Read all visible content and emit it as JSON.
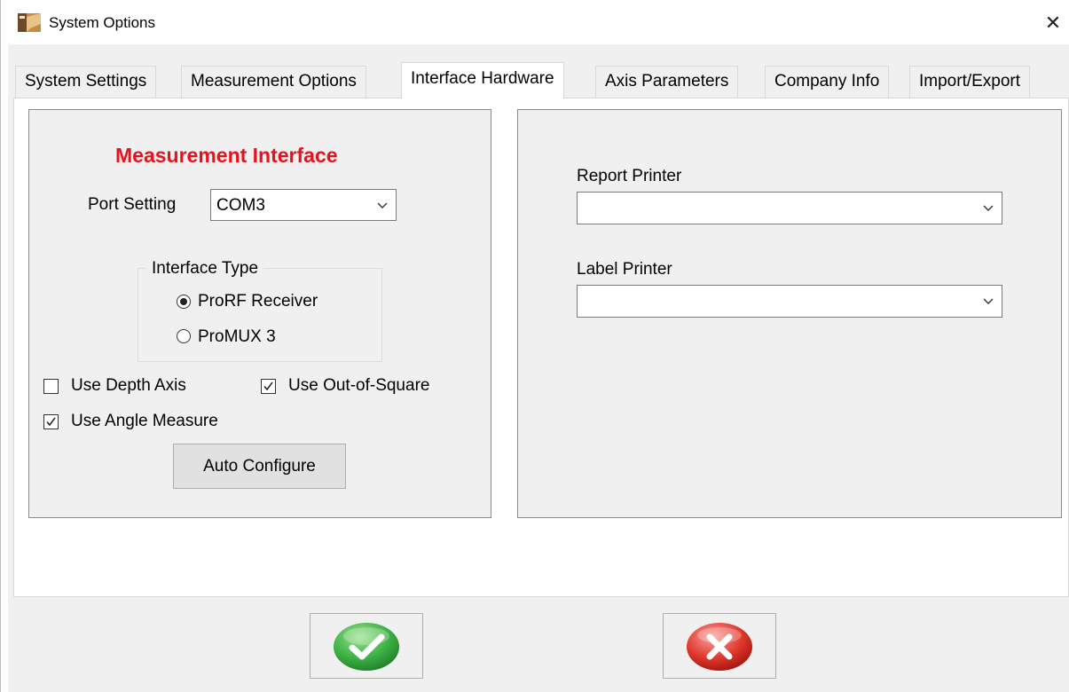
{
  "window": {
    "title": "System Options",
    "icon": "app-icon",
    "close_glyph": "✕"
  },
  "tabs": [
    {
      "label": "System Settings",
      "active": false
    },
    {
      "label": "Measurement Options",
      "active": false
    },
    {
      "label": "Interface Hardware",
      "active": true
    },
    {
      "label": "Axis Parameters",
      "active": false
    },
    {
      "label": "Company Info",
      "active": false
    },
    {
      "label": "Import/Export",
      "active": false
    }
  ],
  "measurement_interface": {
    "heading": "Measurement Interface",
    "heading_color": "#e8121e",
    "port_setting_label": "Port Setting",
    "port_setting_value": "COM3",
    "interface_type": {
      "title": "Interface Type",
      "options": [
        {
          "label": "ProRF Receiver",
          "selected": true
        },
        {
          "label": "ProMUX 3",
          "selected": false
        }
      ]
    },
    "checkboxes": {
      "use_depth_axis": {
        "label": "Use Depth Axis",
        "checked": false
      },
      "use_out_of_square": {
        "label": "Use Out-of-Square",
        "checked": true
      },
      "use_angle_measure": {
        "label": "Use Angle Measure",
        "checked": true
      }
    },
    "auto_configure_label": "Auto Configure"
  },
  "printers": {
    "report_printer_label": "Report Printer",
    "report_printer_value": "",
    "label_printer_label": "Label Printer",
    "label_printer_value": ""
  },
  "footer": {
    "ok_icon": "green-checkmark-icon",
    "cancel_icon": "red-x-icon",
    "ok_color": "#3cb043",
    "cancel_color": "#e0362b"
  }
}
